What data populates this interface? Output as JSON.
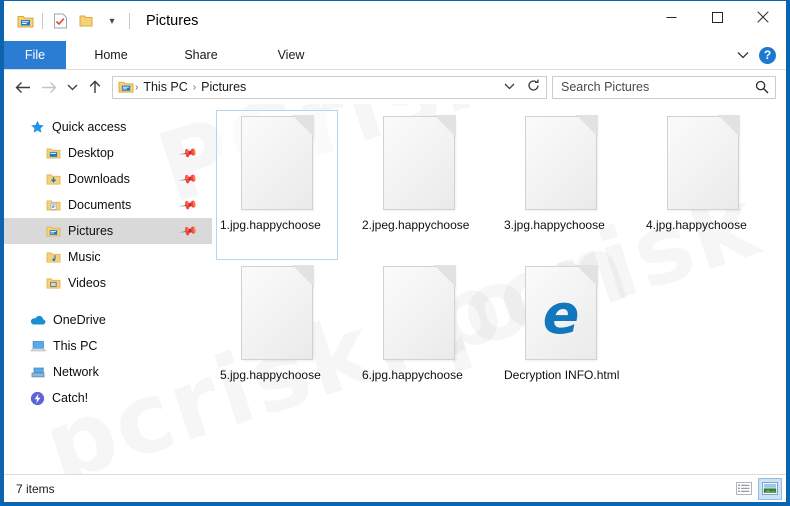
{
  "window": {
    "title": "Pictures",
    "controls": {
      "minimize": "─",
      "maximize": "□",
      "close": "✕"
    },
    "frame_color": "#0b64ad"
  },
  "quick_access_toolbar": {
    "items": [
      {
        "name": "explorer-icon",
        "label": "Properties"
      },
      {
        "name": "properties-icon",
        "label": "Properties"
      },
      {
        "name": "new-folder-icon",
        "label": "New folder"
      }
    ],
    "dropdown": "▾"
  },
  "ribbon": {
    "file_tab": "File",
    "tabs": [
      "Home",
      "Share",
      "View"
    ],
    "expand_chevron": "⌄",
    "help_label": "?",
    "file_tab_color": "#2b7cd3"
  },
  "address_bar": {
    "back": "←",
    "forward": "→",
    "recent": "⌄",
    "up": "↑",
    "breadcrumb": [
      "This PC",
      "Pictures"
    ],
    "breadcrumb_separator": "›",
    "dropdown": "⌄",
    "refresh": "↻"
  },
  "search": {
    "placeholder": "Search Pictures",
    "value": "",
    "icon": "⌕"
  },
  "sidebar": {
    "groups": [
      {
        "root": {
          "label": "Quick access",
          "icon": "star-icon"
        },
        "items": [
          {
            "label": "Desktop",
            "icon": "desktop-folder-icon",
            "pinned": true,
            "selected": false
          },
          {
            "label": "Downloads",
            "icon": "downloads-folder-icon",
            "pinned": true,
            "selected": false
          },
          {
            "label": "Documents",
            "icon": "documents-folder-icon",
            "pinned": true,
            "selected": false
          },
          {
            "label": "Pictures",
            "icon": "pictures-folder-icon",
            "pinned": true,
            "selected": true
          },
          {
            "label": "Music",
            "icon": "music-folder-icon",
            "pinned": false,
            "selected": false
          },
          {
            "label": "Videos",
            "icon": "videos-folder-icon",
            "pinned": false,
            "selected": false
          }
        ]
      }
    ],
    "roots": [
      {
        "label": "OneDrive",
        "icon": "onedrive-icon"
      },
      {
        "label": "This PC",
        "icon": "this-pc-icon"
      },
      {
        "label": "Network",
        "icon": "network-icon"
      },
      {
        "label": "Catch!",
        "icon": "catch-icon"
      }
    ]
  },
  "files": [
    {
      "name": "1.jpg.happychoose",
      "type": "generic",
      "selected": true
    },
    {
      "name": "2.jpeg.happychoose",
      "type": "generic",
      "selected": false
    },
    {
      "name": "3.jpg.happychoose",
      "type": "generic",
      "selected": false
    },
    {
      "name": "4.jpg.happychoose",
      "type": "generic",
      "selected": false
    },
    {
      "name": "5.jpg.happychoose",
      "type": "generic",
      "selected": false
    },
    {
      "name": "6.jpg.happychoose",
      "type": "generic",
      "selected": false
    },
    {
      "name": "Decryption INFO.html",
      "type": "edge-html",
      "selected": false
    }
  ],
  "status_bar": {
    "item_count": "7 items",
    "views": [
      {
        "name": "details-view",
        "active": false
      },
      {
        "name": "large-icons-view",
        "active": true
      }
    ]
  },
  "watermark": {
    "line1": "PCrisk",
    "line2": "pcrisk.com",
    "line3": "pcrisk"
  }
}
